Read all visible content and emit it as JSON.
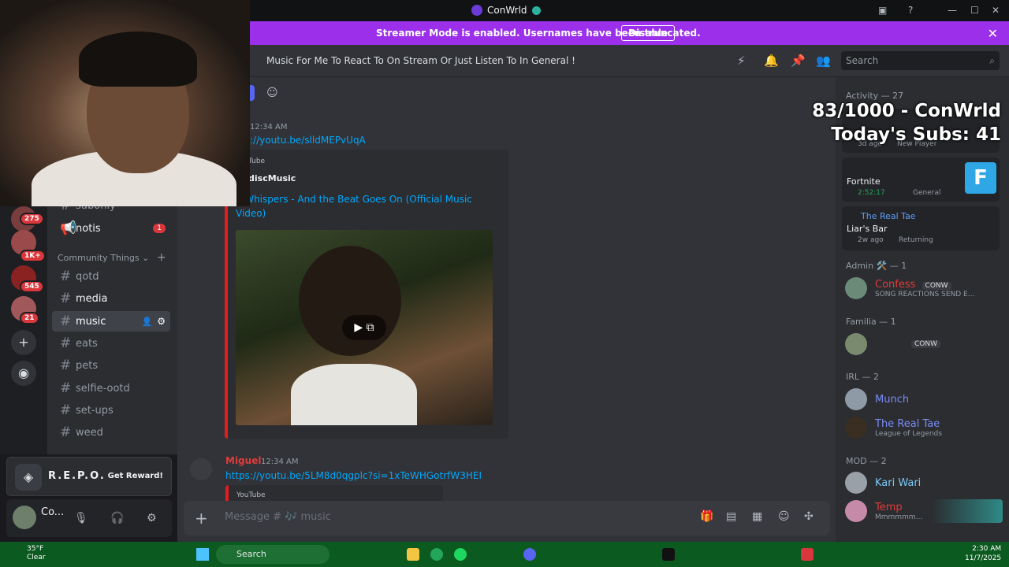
{
  "window": {
    "title": "ConWrld"
  },
  "streamer_banner": {
    "message": "Streamer Mode is enabled. Usernames have been truncated.",
    "disable_label": "Disable"
  },
  "overlay": {
    "line1": "83/1000 - ConWrld",
    "line2": "Today's Subs: 41"
  },
  "server_badges": [
    "275",
    "1K+",
    "545",
    "21"
  ],
  "channels": {
    "truncated_item": "subonly",
    "notis": {
      "label": "notis",
      "badge": "1"
    },
    "category": "Community Things",
    "items": [
      "qotd",
      "media",
      "music",
      "eats",
      "pets",
      "selfie-ootd",
      "set-ups",
      "weed"
    ]
  },
  "reward": {
    "name": "R.E.P.O.",
    "cta": "Get Reward!"
  },
  "user": {
    "name": "Co..."
  },
  "header": {
    "topic": "Music For Me To React To On Stream Or Just Listen To In General !",
    "search_placeholder": "Search"
  },
  "messages": [
    {
      "time": "12:34 AM",
      "link": "://youtu.be/slldMEPvUqA",
      "embed_provider": "Tube",
      "embed_author": "discMusic",
      "embed_title": "e Whispers - And the Beat Goes On (Official Music Video)"
    },
    {
      "author": "Miguel",
      "time": "12:34 AM",
      "link": "https://youtu.be/5LM8d0qgplc?si=1xTeWHGotrfW3HEI",
      "embed_provider": "YouTube"
    }
  ],
  "composer": {
    "placeholder": "Message # 🎶 music"
  },
  "members": {
    "activity_header": "Activity — 27",
    "activities": [
      {
        "game": "Fortnite",
        "elapsed": "2:52:17",
        "channel": "General"
      },
      {
        "user": "The Real Tae",
        "game": "Liar's Bar",
        "ago": "2w ago",
        "status": "Returning"
      }
    ],
    "activity_partial": {
      "ago": "3d ago",
      "status": "New Player"
    },
    "sections": [
      {
        "title": "Admin 🛠️ — 1",
        "members": [
          {
            "name": "Confess",
            "tag": "CONW",
            "status": "SONG REACTIONS SEND E..."
          }
        ]
      },
      {
        "title": "Familia — 1",
        "members": [
          {
            "name": "",
            "tag": "CONW"
          }
        ]
      },
      {
        "title": "IRL — 2",
        "members": [
          {
            "name": "Munch"
          },
          {
            "name": "The Real Tae",
            "status": "League of Legends"
          }
        ]
      },
      {
        "title": "MOD — 2",
        "members": [
          {
            "name": "Kari Wari"
          },
          {
            "name": "Temp",
            "status": "Mmmmmm..."
          }
        ]
      }
    ]
  },
  "taskbar": {
    "weather_temp": "35°F",
    "weather_desc": "Clear",
    "search_label": "Search",
    "time": "2:30 AM",
    "date": "11/7/2025"
  },
  "colors": {
    "banner": "#9b2fea",
    "link": "#00a8fc",
    "taskbar": "#0b5a1f",
    "embed_accent": "#e61c1c"
  }
}
